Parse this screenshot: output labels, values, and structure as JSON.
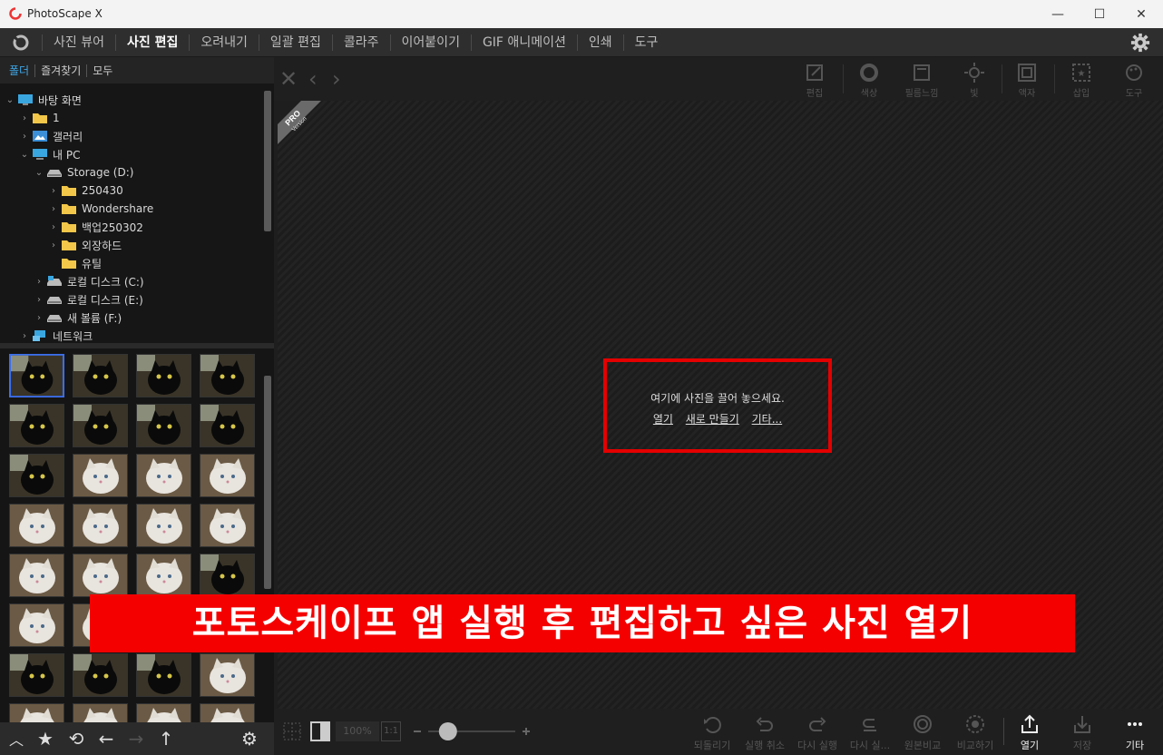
{
  "window": {
    "title": "PhotoScape X",
    "controls": [
      "—",
      "☐",
      "✕"
    ]
  },
  "menus": [
    "사진 뷰어",
    "사진 편집",
    "오려내기",
    "일괄 편집",
    "콜라주",
    "이어붙이기",
    "GIF 애니메이션",
    "인쇄",
    "도구"
  ],
  "active_menu": "사진 편집",
  "left_tabs": [
    "폴더",
    "즐겨찾기",
    "모두"
  ],
  "tree": [
    {
      "label": "바탕 화면",
      "icon": "desktop-icon",
      "depth": 0,
      "state": "expanded"
    },
    {
      "label": "1",
      "icon": "folder-icon",
      "depth": 1,
      "state": "collapsed"
    },
    {
      "label": "갤러리",
      "icon": "gallery-icon",
      "depth": 1,
      "state": "collapsed"
    },
    {
      "label": "내 PC",
      "icon": "pc-icon",
      "depth": 1,
      "state": "expanded"
    },
    {
      "label": "Storage (D:)",
      "icon": "drive-icon",
      "depth": 2,
      "state": "expanded"
    },
    {
      "label": "250430",
      "icon": "folder-icon",
      "depth": 3,
      "state": "collapsed"
    },
    {
      "label": "Wondershare",
      "icon": "folder-icon",
      "depth": 3,
      "state": "collapsed"
    },
    {
      "label": "백업250302",
      "icon": "folder-icon",
      "depth": 3,
      "state": "collapsed"
    },
    {
      "label": "외장하드",
      "icon": "folder-icon",
      "depth": 3,
      "state": "collapsed"
    },
    {
      "label": "유틸",
      "icon": "folder-icon",
      "depth": 3,
      "state": "none"
    },
    {
      "label": "로컬 디스크 (C:)",
      "icon": "system-drive-icon",
      "depth": 2,
      "state": "collapsed"
    },
    {
      "label": "로컬 디스크 (E:)",
      "icon": "drive-icon",
      "depth": 2,
      "state": "collapsed"
    },
    {
      "label": "새 볼륨 (F:)",
      "icon": "drive-icon",
      "depth": 2,
      "state": "collapsed"
    },
    {
      "label": "네트워크",
      "icon": "network-icon",
      "depth": 1,
      "state": "collapsed"
    }
  ],
  "thumbnails": {
    "rows": [
      [
        "black-cat",
        "black-cat",
        "black-cat",
        "black-cat"
      ],
      [
        "black-cat",
        "black-cat",
        "black-cat",
        "black-cat"
      ],
      [
        "black-cat",
        "white-cat",
        "white-cat",
        "white-cat"
      ],
      [
        "white-cat",
        "white-cat",
        "white-cat",
        "white-cat"
      ],
      [
        "white-cat",
        "white-cat",
        "white-cat",
        "black-cat"
      ],
      [
        "white-cat",
        "white-cat",
        "white-cat",
        "white-cat"
      ],
      [
        "black-cat",
        "black-cat",
        "black-cat",
        "white-cat"
      ],
      [
        "white-cat",
        "white-cat",
        "white-cat",
        "white-cat"
      ]
    ],
    "selected_index": 0
  },
  "left_bottom_icons": [
    "chevron-up-icon",
    "star-icon",
    "refresh-icon",
    "arrow-left-icon",
    "arrow-right-icon",
    "arrow-up-icon",
    "gear-icon"
  ],
  "toolbar": {
    "nav": [
      "✕",
      "‹",
      "›"
    ],
    "tools": [
      "편집",
      "색상",
      "필름느낌",
      "빛",
      "액자",
      "삽입",
      "도구"
    ]
  },
  "canvas": {
    "badge_top": "PRO",
    "badge_bottom": "Version",
    "drop_text": "여기에 사진을 끌어 놓으세요.",
    "links": [
      "열기",
      "새로 만들기",
      "기타..."
    ]
  },
  "bottom": {
    "zoom": "100%",
    "one_to_one": "1:1",
    "zoom_level": 0.05,
    "buttons": [
      "되돌리기",
      "실행 취소",
      "다시 실행",
      "다시 실...",
      "원본비교",
      "비교하기",
      "열기",
      "저장",
      "기타"
    ],
    "enabled_buttons": [
      "열기",
      "기타"
    ]
  },
  "banner": "포토스케이프 앱 실행 후 편집하고 싶은 사진 열기",
  "colors": {
    "accent_blue": "#3fa7e8",
    "highlight_red": "#e40000",
    "banner_red": "#f50000",
    "folder_yellow": "#f2c74a"
  }
}
